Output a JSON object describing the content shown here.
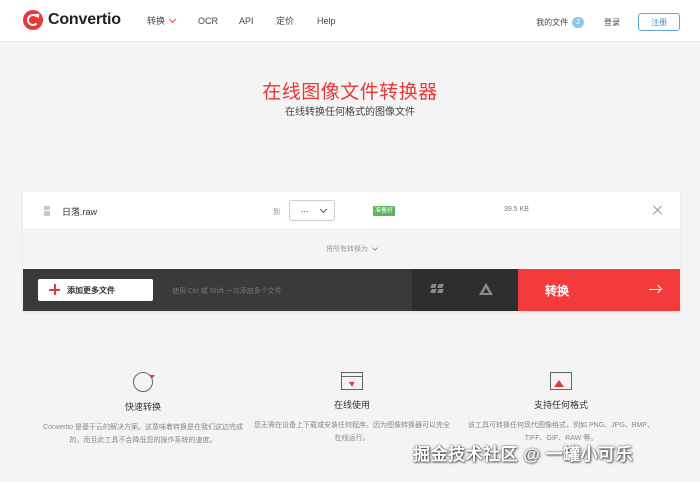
{
  "brand": {
    "name": "Convertio",
    "accent_color": "#e53935"
  },
  "nav": {
    "convert": "转换",
    "ocr": "OCR",
    "api": "API",
    "pricing": "定价",
    "help": "Help"
  },
  "account": {
    "my_files": "我的文件",
    "files_count": "2",
    "login": "登录",
    "signup": "注册"
  },
  "hero": {
    "title": "在线图像文件转换器",
    "subtitle": "在线转换任何格式的图像文件"
  },
  "file": {
    "name": "日落.raw",
    "to_label": "到",
    "format_value": "...",
    "status": "准备好",
    "size": "39.5 KB"
  },
  "convert_all": {
    "label": "将所有转换为"
  },
  "actions": {
    "add_more_label": "添加更多文件",
    "hint": "使用 Ctrl 或 Shift 一次添加多个文件",
    "convert_label": "转换"
  },
  "features": [
    {
      "title": "快速转换",
      "desc": "Convertio 是基于云的解决方案。这意味着转换是在我们这边完成的，而且此工具不会降低您的操作系统的速度。",
      "icon": "sync-icon"
    },
    {
      "title": "在线使用",
      "desc": "您无需在设备上下载或安装任何程序。因为图像转换器可以完全在线运行。",
      "icon": "browser-cursor-icon"
    },
    {
      "title": "支持任何格式",
      "desc": "该工具可转换任何现代图像格式，例如 PNG、JPG、BMP、TIFF、GIF、RAW 等。",
      "icon": "image-icon"
    }
  ],
  "watermark": "掘金技术社区 @ 一罐小可乐"
}
